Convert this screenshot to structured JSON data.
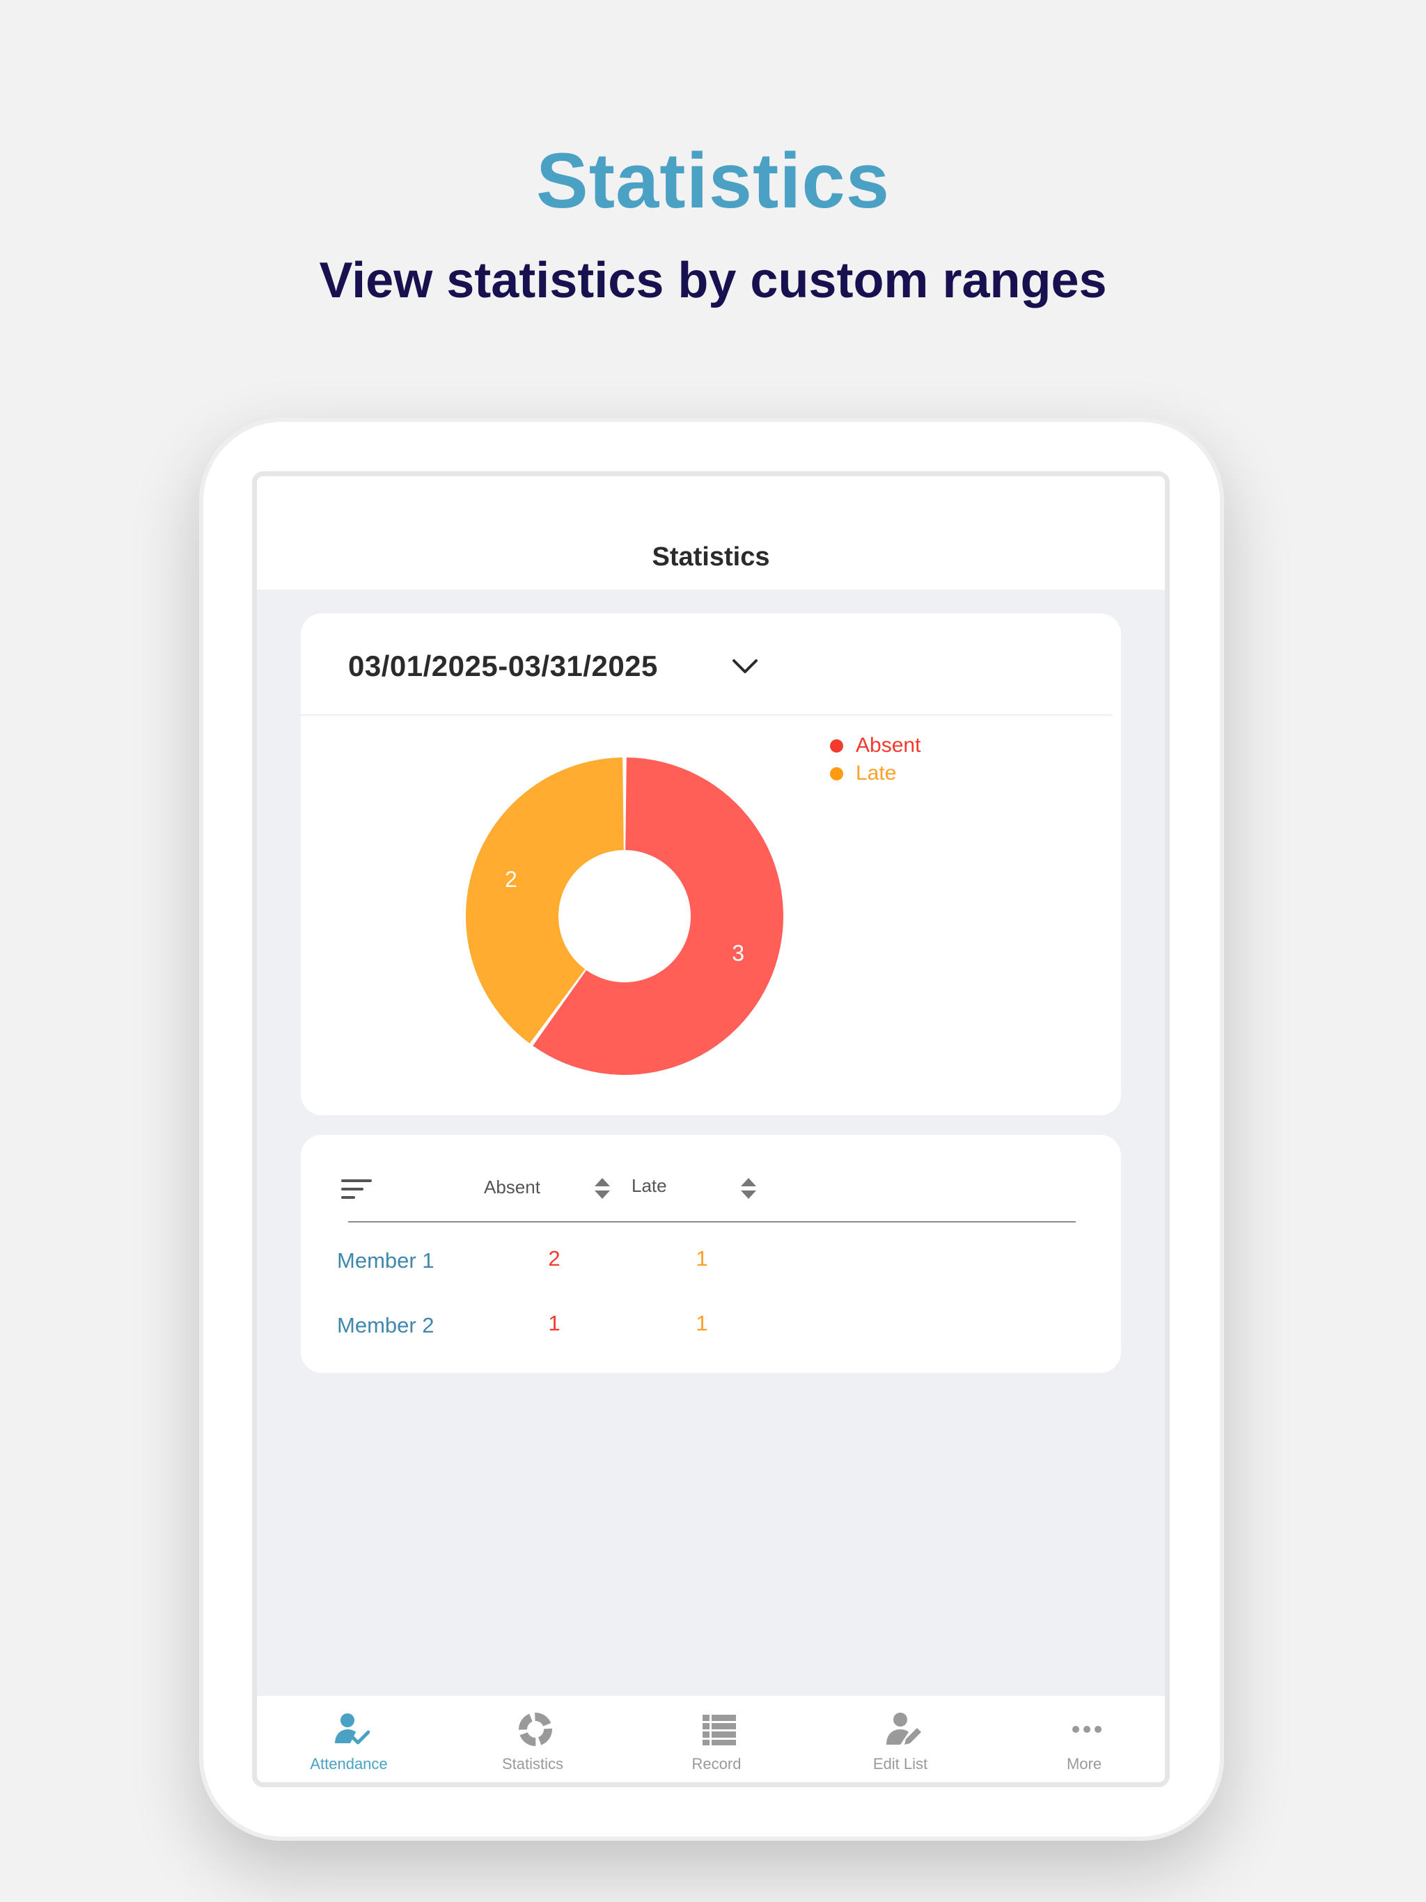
{
  "hero": {
    "title": "Statistics",
    "subtitle": "View statistics by custom ranges"
  },
  "app": {
    "header_title": "Statistics",
    "date_range": "03/01/2025-03/31/2025"
  },
  "chart_data": {
    "type": "pie",
    "categories": [
      "Absent",
      "Late"
    ],
    "values": [
      3,
      2
    ],
    "colors": [
      "#ff5f57",
      "#ffac30"
    ],
    "legend_position": "top-right",
    "legend": [
      {
        "label": "Absent",
        "dot_color": "#f23a2f",
        "text_color": "#f23a2f"
      },
      {
        "label": "Late",
        "dot_color": "#ff9b12",
        "text_color": "#ffa028"
      }
    ]
  },
  "table": {
    "columns": [
      "Absent",
      "Late"
    ],
    "rows": [
      {
        "name": "Member 1",
        "absent": "2",
        "late": "1"
      },
      {
        "name": "Member 2",
        "absent": "1",
        "late": "1"
      }
    ]
  },
  "tabs": [
    {
      "label": "Attendance",
      "icon": "attendance-icon",
      "active": true
    },
    {
      "label": "Statistics",
      "icon": "statistics-icon",
      "active": false
    },
    {
      "label": "Record",
      "icon": "record-icon",
      "active": false
    },
    {
      "label": "Edit List",
      "icon": "edit-list-icon",
      "active": false
    },
    {
      "label": "More",
      "icon": "more-icon",
      "active": false
    }
  ],
  "colors": {
    "hero_title": "#4aa1c4",
    "hero_subtitle": "#17124f",
    "absent": "#f23a2f",
    "late": "#ffa028",
    "active_tab": "#4aa1c4",
    "inactive_tab": "#9a9a9a"
  }
}
